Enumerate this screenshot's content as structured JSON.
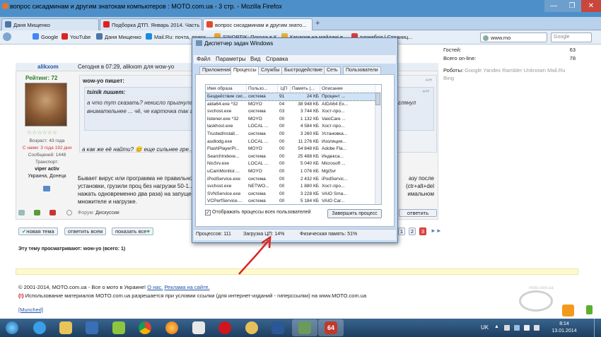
{
  "window": {
    "title": "вопрос сисадминам и другим знатокам компьютеров : MOTO.com.ua - 3 стр. - Mozilla Firefox",
    "minimize": "—",
    "maximize": "❐",
    "close": "✕"
  },
  "tabs": [
    {
      "label": "Даня Мищенко"
    },
    {
      "label": "Подборка ДТП. Январь 2014. Часть ..."
    },
    {
      "label": "вопрос сисадминам и другим знато..."
    }
  ],
  "bookmarks": [
    {
      "label": "Google"
    },
    {
      "label": "YouTube"
    },
    {
      "label": "Даня Мищенко"
    },
    {
      "label": "Mail.Ru: почта, поиск ..."
    },
    {
      "label": "SINOPTIK: Погода в К..."
    },
    {
      "label": "Караоке на майдані в..."
    },
    {
      "label": "турнабол | Страниц..."
    }
  ],
  "url": "www.mo",
  "search_placeholder": "Google",
  "sidebar": {
    "guests_label": "Гостей:",
    "guests_value": "63",
    "online_label": "Всего on-line:",
    "online_value": "78",
    "robots_label": "Роботы:",
    "robots": "Google Yandex Rambler Unknown Mail.Ru Bing"
  },
  "post": {
    "author": "alikxom",
    "date": "Сегодня в 07:29, alikxom для wow-yo",
    "rating_label": "Рейтинг:",
    "rating_value": "72",
    "age": "Возраст: 43 года",
    "since": "С нами: 3 года 192 дня",
    "messages": "Сообщений: 1448",
    "transport_label": "Транспорт:",
    "transport": "viper activ",
    "location": "Украина, Донецк",
    "quote1_head": "wow-yo пишет:",
    "quote2_head": "tsinik пишет:",
    "quote2_text": "а что тут сказать? некисло прыгнула ... мы, т, частом, не пытался камень разогнать? ну, ут... П.С. Только что глянул внимательнее ... чё, че карточка так греется. камень, как-бы...",
    "reply_text": "а как же её найти? 😊 еще сильнее гре...",
    "body_line1": "Бывает вирус или программа не правильно ...",
    "body_line1_tail": "азу после",
    "body_line2": "установки, грузили проц без нагрузки 50-1...",
    "body_line2_tail": "(ctr+alt+del",
    "body_line3": "нажать одновременно два раза) на запуще...",
    "body_line3_tail": "имальном",
    "body_line4": "множителе и нагрузке.",
    "forum_label": "Форум:",
    "forum_value": "Дискуссии",
    "reply_button": "ответить"
  },
  "actions": {
    "new_topic": "новая тема",
    "reply_all": "ответить всем",
    "show_all": "показать все"
  },
  "pages": [
    "1",
    "2",
    "3"
  ],
  "viewers": "Эту тему просматривают: wow-yo (всего: 1)",
  "footer": {
    "copyright": "© 2001-2014, MOTO.com.ua - Все о мото в Украине!",
    "about": "О нас.",
    "ads": "Реклама на сайте.",
    "notice_mark": "(!)",
    "notice": "Использование материалов MOTO.com.ua разрешается при условии ссылки (для интернет-изданий - гиперссылки) на www.MOTO.com.ua",
    "munched": "[Munched]",
    "watermark": "moto.com.ua"
  },
  "taskmgr": {
    "title": "Диспетчер задач Windows",
    "menu": [
      "Файл",
      "Параметры",
      "Вид",
      "Справка"
    ],
    "tabs": [
      "Приложения",
      "Процессы",
      "Службы",
      "Быстродействие",
      "Сеть",
      "Пользователи"
    ],
    "columns": [
      "Имя образа",
      "Пользо...",
      "ЦП",
      "Память (...",
      "Описание"
    ],
    "rows": [
      {
        "name": "Бездействие сис...",
        "user": "система",
        "cpu": "91",
        "mem": "24 КБ",
        "desc": "Процент ..."
      },
      {
        "name": "aida64.exe *32",
        "user": "MOYO",
        "cpu": "04",
        "mem": "38 948 КБ",
        "desc": "AIDA64 Ex..."
      },
      {
        "name": "svchost.exe",
        "user": "система",
        "cpu": "03",
        "mem": "3 744 КБ",
        "desc": "Хост-про..."
      },
      {
        "name": "listener.exe *32",
        "user": "MOYO",
        "cpu": "00",
        "mem": "1 132 КБ",
        "desc": "VaioCare ..."
      },
      {
        "name": "taskhost.exe",
        "user": "LOCAL ...",
        "cpu": "00",
        "mem": "4 584 КБ",
        "desc": "Хост-про..."
      },
      {
        "name": "TrustedInstall...",
        "user": "система",
        "cpu": "00",
        "mem": "3 260 КБ",
        "desc": "Установка..."
      },
      {
        "name": "audiodg.exe",
        "user": "LOCAL ...",
        "cpu": "00",
        "mem": "11 276 КБ",
        "desc": "Изоляция..."
      },
      {
        "name": "FlashPlayerPl...",
        "user": "MOYO",
        "cpu": "00",
        "mem": "54 848 КБ",
        "desc": "Adobe Fla..."
      },
      {
        "name": "SearchIndexe...",
        "user": "система",
        "cpu": "00",
        "mem": "25 488 КБ",
        "desc": "Индекса..."
      },
      {
        "name": "NisSrv.exe",
        "user": "LOCAL ...",
        "cpu": "00",
        "mem": "5 040 КБ",
        "desc": "Microsoft ..."
      },
      {
        "name": "uCamMonitor....",
        "user": "MOYO",
        "cpu": "00",
        "mem": "1 076 КБ",
        "desc": "MgiSvr"
      },
      {
        "name": "iPodService.exe",
        "user": "система",
        "cpu": "00",
        "mem": "2 432 КБ",
        "desc": "iPodServic..."
      },
      {
        "name": "svchost.exe",
        "user": "NETWO...",
        "cpu": "00",
        "mem": "1 880 КБ",
        "desc": "Хост-про..."
      },
      {
        "name": "SVNService.exe",
        "user": "система",
        "cpu": "00",
        "mem": "3 228 КБ",
        "desc": "VAIO Sma..."
      },
      {
        "name": "VCPerfService....",
        "user": "система",
        "cpu": "00",
        "mem": "5 184 КБ",
        "desc": "VAIO Car..."
      }
    ],
    "show_all_label": "Отображать процессы всех пользователей",
    "end_process": "Завершить процесс",
    "status_processes": "Процессов: 111",
    "status_cpu": "Загрузка ЦП: 14%",
    "status_memory": "Физическая память: 51%"
  },
  "tray": {
    "lang": "UK",
    "time": "8:14",
    "date": "13.01.2014"
  },
  "taskbar": {
    "app64": "64"
  }
}
